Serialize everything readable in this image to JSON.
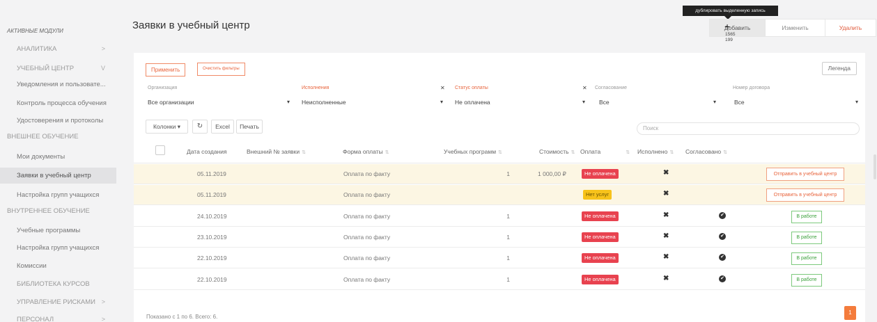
{
  "sidebar": {
    "section_title": "АКТИВНЫЕ МОДУЛИ",
    "items": [
      {
        "label": "АНАЛИТИКА",
        "chevron": ">"
      },
      {
        "label": "УЧЕБНЫЙ ЦЕНТР",
        "chevron": "v"
      },
      {
        "label": "Уведомления и пользовате..."
      },
      {
        "label": "Контроль процесса обучения"
      },
      {
        "label": "Удостоверения и протоколы"
      },
      {
        "label": "ВНЕШНЕЕ ОБУЧЕНИЕ"
      },
      {
        "label": "Мои документы"
      },
      {
        "label": "Заявки в учебный центр"
      },
      {
        "label": "Настройка групп учащихся"
      },
      {
        "label": "ВНУТРЕННЕЕ ОБУЧЕНИЕ"
      },
      {
        "label": "Учебные программы"
      },
      {
        "label": "Настройка групп учащихся"
      },
      {
        "label": "Комиссии"
      },
      {
        "label": "БИБЛИОТЕКА КУРСОВ"
      },
      {
        "label": "УПРАВЛЕНИЕ РИСКАМИ",
        "chevron": ">"
      },
      {
        "label": "ПЕРСОНАЛ",
        "chevron": ">"
      }
    ]
  },
  "header": {
    "title": "Заявки в учебный центр",
    "tooltip": "дублировать выделенную запись",
    "add_label": "Добавить",
    "edit_label": "Изменить",
    "delete_label": "Удалить",
    "cursor_x": "1565",
    "cursor_y": "199"
  },
  "toolbar": {
    "apply_label": "Применить",
    "clear_label": "Очистить фильтры",
    "legend_label": "Легенда",
    "columns_label": "Колонки ▾",
    "refresh_icon": "refresh-icon",
    "excel_label": "Excel",
    "print_label": "Печать",
    "search_placeholder": "Поиск"
  },
  "filters": [
    {
      "label": "Организация",
      "value": "Все организации",
      "accent": false
    },
    {
      "label": "Исполнения",
      "value": "Неисполненные",
      "accent": true
    },
    {
      "label": "Статус оплаты",
      "value": "Не оплачена",
      "accent": true
    },
    {
      "label": "Согласование",
      "value": "Все",
      "accent": false
    },
    {
      "label": "Номер договора",
      "value": "Все",
      "accent": false
    }
  ],
  "table": {
    "columns": [
      "Дата создания",
      "Внешний № заявки",
      "Форма оплаты",
      "Учебных программ",
      "Стоимость",
      "Оплата",
      "Исполнено",
      "Согласовано"
    ],
    "rows": [
      {
        "date": "05.11.2019",
        "ext_no": "",
        "payment_form": "Оплата по факту",
        "programs": "1",
        "cost": "1 000,00 ₽",
        "payment": "Не оплачена",
        "payment_color": "red",
        "done": "✖",
        "agreed": "",
        "action": "Отправить в учебный центр",
        "action_type": "orange",
        "highlight": true
      },
      {
        "date": "05.11.2019",
        "ext_no": "",
        "payment_form": "Оплата по факту",
        "programs": "",
        "cost": "",
        "payment": "Нет услуг",
        "payment_color": "yellow",
        "done": "✖",
        "agreed": "",
        "action": "Отправить в учебный центр",
        "action_type": "orange",
        "highlight": true
      },
      {
        "date": "24.10.2019",
        "ext_no": "",
        "payment_form": "Оплата по факту",
        "programs": "1",
        "cost": "",
        "payment": "Не оплачена",
        "payment_color": "red",
        "done": "✖",
        "agreed": "✔",
        "action": "В работе",
        "action_type": "green",
        "highlight": false
      },
      {
        "date": "23.10.2019",
        "ext_no": "",
        "payment_form": "Оплата по факту",
        "programs": "1",
        "cost": "",
        "payment": "Не оплачена",
        "payment_color": "red",
        "done": "✖",
        "agreed": "✔",
        "action": "В работе",
        "action_type": "green",
        "highlight": false
      },
      {
        "date": "22.10.2019",
        "ext_no": "",
        "payment_form": "Оплата по факту",
        "programs": "1",
        "cost": "",
        "payment": "Не оплачена",
        "payment_color": "red",
        "done": "✖",
        "agreed": "✔",
        "action": "В работе",
        "action_type": "green",
        "highlight": false
      },
      {
        "date": "22.10.2019",
        "ext_no": "",
        "payment_form": "Оплата по факту",
        "programs": "1",
        "cost": "",
        "payment": "Не оплачена",
        "payment_color": "red",
        "done": "✖",
        "agreed": "✔",
        "action": "В работе",
        "action_type": "green",
        "highlight": false
      }
    ]
  },
  "footer": {
    "summary": "Показано с 1 по 6. Всего: 6.",
    "page": "1"
  },
  "colors": {
    "accent": "#e8643c",
    "danger": "#e8424f",
    "warning": "#f7c21b",
    "success": "#3aa03a"
  }
}
